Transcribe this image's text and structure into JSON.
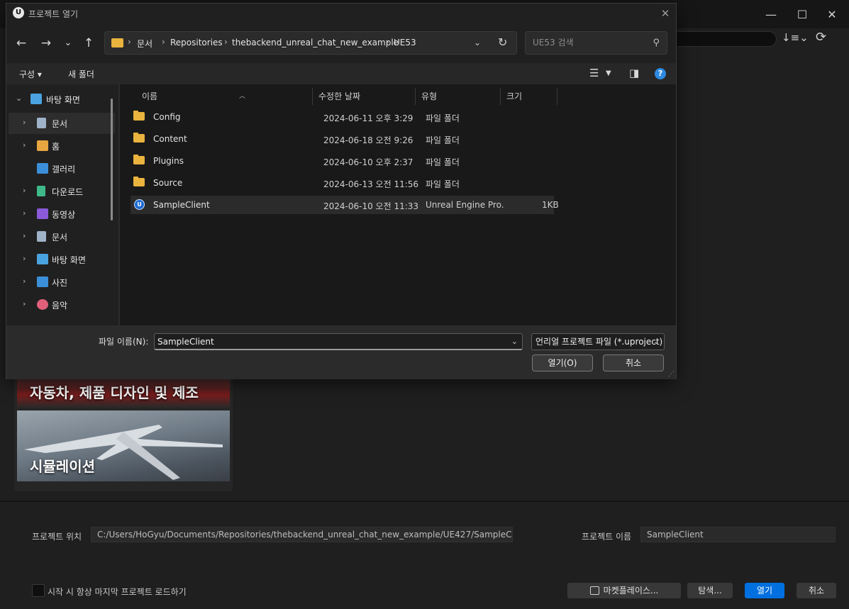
{
  "ue_browser": {
    "window_controls": {
      "minimize": "—",
      "maximize": "☐",
      "close": "✕"
    },
    "toolbar": {
      "sort": "↓≡⌄",
      "refresh": "⟳"
    },
    "tiles": [
      {
        "label": "자동차, 제품 디자인 및 제조"
      },
      {
        "label": "시뮬레이션"
      }
    ],
    "project_location_label": "프로젝트 위치",
    "project_location_value": "C:/Users/HoGyu/Documents/Repositories/thebackend_unreal_chat_new_example/UE427/SampleC",
    "project_name_label": "프로젝트 이름",
    "project_name_value": "SampleClient",
    "startup_checkbox_label": "시작 시 항상 마지막 프로젝트 로드하기",
    "buttons": {
      "marketplace": "마켓플레이스...",
      "browse": "탐색...",
      "open": "열기",
      "cancel": "취소"
    }
  },
  "dialog": {
    "title": "프로젝트 열기",
    "close": "✕",
    "nav": {
      "back": "←",
      "forward": "→",
      "recent": "⌄",
      "up": "↑"
    },
    "breadcrumbs": [
      "문서",
      "Repositories",
      "thebackend_unreal_chat_new_example",
      "UE53"
    ],
    "search_placeholder": "UE53 검색",
    "search_icon": "⚲",
    "commands": {
      "organize": "구성 ▾",
      "new_folder": "새 폴더"
    },
    "sidebar": [
      {
        "label": "바탕 화면",
        "icon": "desktop-icon",
        "color": "#4aa3df",
        "expanded": true
      },
      {
        "label": "문서",
        "icon": "documents-icon",
        "color": "#9fb3c8",
        "selected": true
      },
      {
        "label": "홈",
        "icon": "home-icon",
        "color": "#e8a640"
      },
      {
        "label": "갤러리",
        "icon": "gallery-icon",
        "color": "#3b8fd9"
      },
      {
        "label": "다운로드",
        "icon": "download-icon",
        "color": "#3fb98a"
      },
      {
        "label": "동영상",
        "icon": "videos-icon",
        "color": "#8a5ad8"
      },
      {
        "label": "문서",
        "icon": "documents-icon",
        "color": "#9fb3c8"
      },
      {
        "label": "바탕 화면",
        "icon": "desktop-icon",
        "color": "#4aa3df"
      },
      {
        "label": "사진",
        "icon": "pictures-icon",
        "color": "#3b8fd9"
      },
      {
        "label": "음악",
        "icon": "music-icon",
        "color": "#e0607a"
      }
    ],
    "columns": [
      "이름",
      "수정한 날짜",
      "유형",
      "크기"
    ],
    "files": [
      {
        "name": "Config",
        "date": "2024-06-11 오후 3:29",
        "type": "파일 폴더",
        "size": "",
        "kind": "folder"
      },
      {
        "name": "Content",
        "date": "2024-06-18 오전 9:26",
        "type": "파일 폴더",
        "size": "",
        "kind": "folder"
      },
      {
        "name": "Plugins",
        "date": "2024-06-10 오후 2:37",
        "type": "파일 폴더",
        "size": "",
        "kind": "folder"
      },
      {
        "name": "Source",
        "date": "2024-06-13 오전 11:56",
        "type": "파일 폴더",
        "size": "",
        "kind": "folder"
      },
      {
        "name": "SampleClient",
        "date": "2024-06-10 오전 11:33",
        "type": "Unreal Engine Pro...",
        "size": "1KB",
        "kind": "uproject",
        "selected": true
      }
    ],
    "filename_label": "파일 이름(N):",
    "filename_value": "SampleClient",
    "filetype_value": "언리얼 프로젝트 파일 (*.uproject)",
    "open_button": "열기(O)",
    "cancel_button": "취소"
  }
}
